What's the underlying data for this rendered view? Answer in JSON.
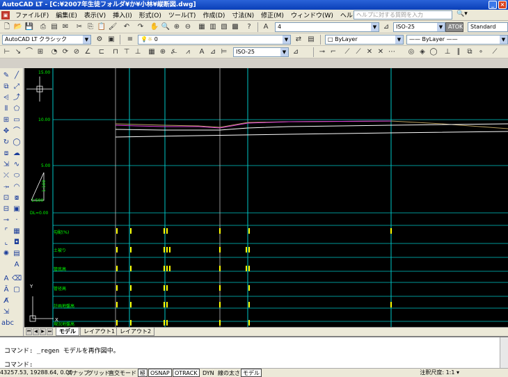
{
  "window": {
    "title": "AutoCAD LT - [C:¥2007年生徒フォルダ¥か¥小林¥縦断図.dwg]"
  },
  "menu": {
    "items": [
      "ファイル(F)",
      "編集(E)",
      "表示(V)",
      "挿入(I)",
      "形式(O)",
      "ツール(T)",
      "作成(D)",
      "寸法(N)",
      "修正(M)",
      "ウィンドウ(W)",
      "ヘルプ(H)"
    ],
    "help_placeholder": "ヘルプに対する質問を入力"
  },
  "toolbar1": {
    "lineweight_value": "4",
    "dimstyle_value": "ISO-25",
    "textstyle_value": "Standard",
    "ime_label": "ATOK あ 連 R 漢"
  },
  "toolbar2": {
    "workspace_value": "AutoCAD LT クラシック",
    "layer_value": "0",
    "color_value": "ByLayer",
    "linetype_value": "ByLayer"
  },
  "toolbar3": {
    "dimstyle_value": "ISO-25"
  },
  "canvas": {
    "y_labels": [
      "15.00",
      "10.00",
      "5.00",
      "DL=0.00"
    ],
    "scale_label": "1:500",
    "vscale_label": "1:100",
    "row_labels": [
      "勾配(%)",
      "土被り",
      "管底高",
      "管径高",
      "計画地盤高",
      "現況地盤高"
    ],
    "ucs_y": "Y",
    "ucs_x": "X"
  },
  "tabs": {
    "items": [
      "モデル",
      "レイアウト1",
      "レイアウト2"
    ],
    "active": 0
  },
  "command": {
    "history": "コマンド: _regen モデルを再作図中。",
    "prompt": "コマンド:"
  },
  "status": {
    "coords": "43257.53, 19288.64, 0.00",
    "buttons": [
      "スナップ",
      "グリッド",
      "直交モード",
      "極",
      "OSNAP",
      "OTRACK",
      "DYN",
      "線の太さ",
      "モデル"
    ],
    "active_buttons": [
      "極",
      "OSNAP",
      "OTRACK",
      "モデル"
    ],
    "annotation_scale": "注釈尺度: 1:1 ▾"
  },
  "colors": {
    "canvas_bg": "#000000",
    "grid_cyan": "#00c8c8",
    "profile_magenta": "#e040e0",
    "profile_white": "#ffffff",
    "profile_yellow": "#b8a060",
    "label_green": "#00ff00"
  }
}
